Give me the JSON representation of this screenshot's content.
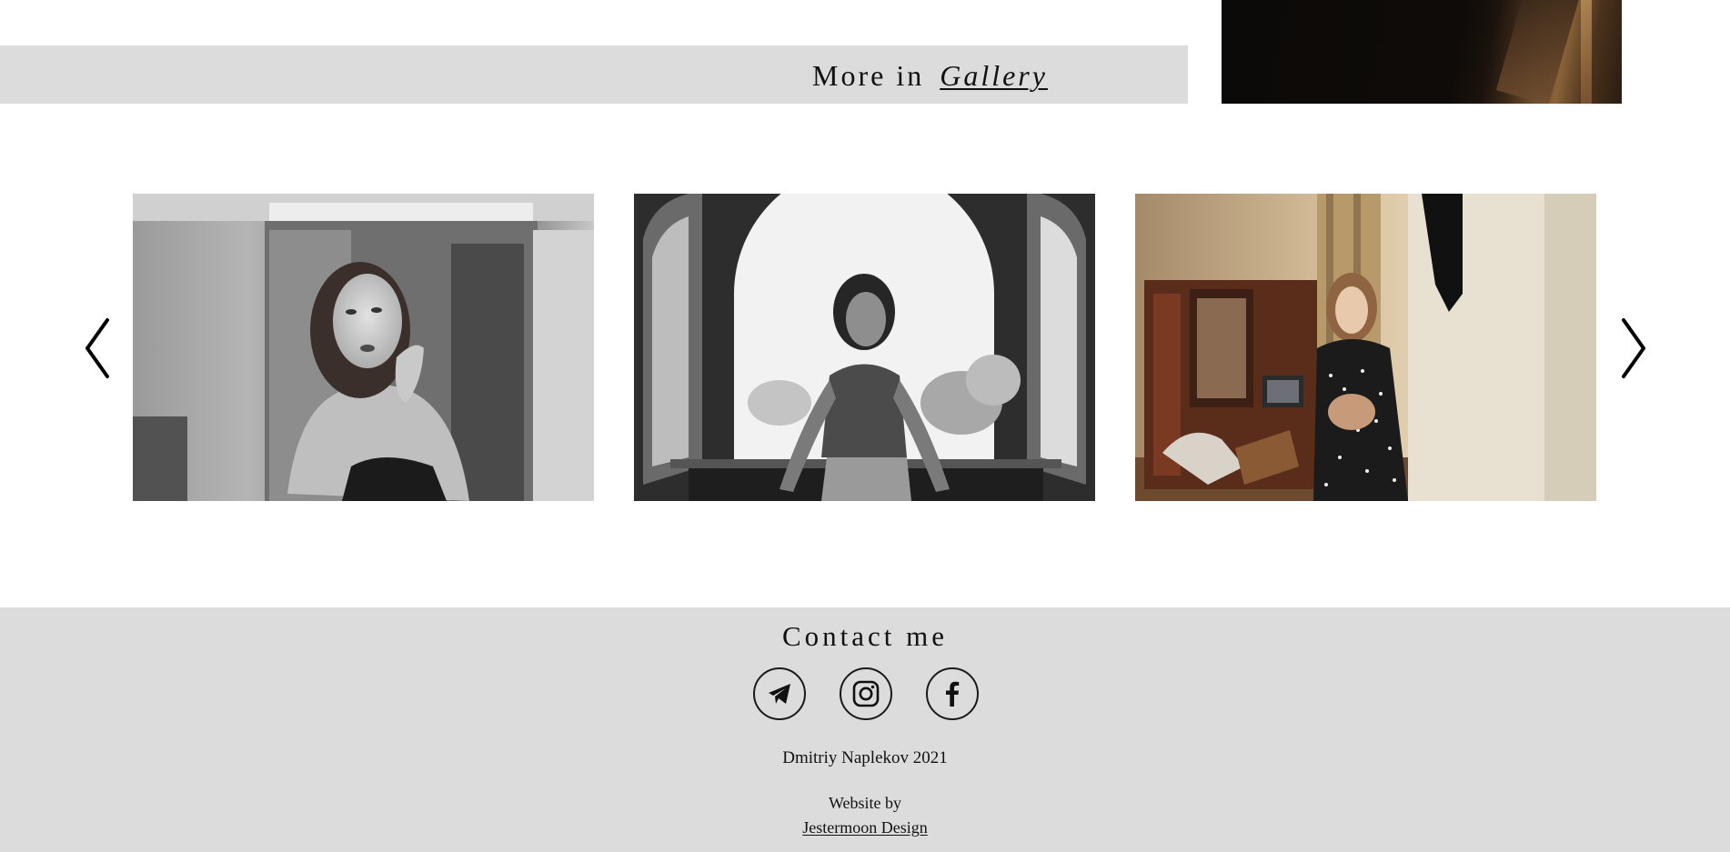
{
  "gallery_link": {
    "prefix": "More in",
    "link_label": "Gallery"
  },
  "carousel": {
    "prev_icon": "chevron-left-icon",
    "next_icon": "chevron-right-icon",
    "photos": [
      {
        "name": "photo-mirror-portrait",
        "description_icon": "photo",
        "tone": "black-and-white"
      },
      {
        "name": "photo-window-portrait",
        "description_icon": "photo",
        "tone": "black-and-white"
      },
      {
        "name": "photo-room-portrait",
        "description_icon": "photo",
        "tone": "color"
      }
    ]
  },
  "footer": {
    "title": "Contact me",
    "social": [
      {
        "icon": "telegram-icon"
      },
      {
        "icon": "instagram-icon"
      },
      {
        "icon": "facebook-icon"
      }
    ],
    "copyright": "Dmitriy Naplekov 2021",
    "credit_label": "Website by",
    "credit_link": "Jestermoon Design"
  },
  "colors": {
    "band_background": "#dcdcdc",
    "text": "#111111",
    "page_background": "#ffffff"
  }
}
